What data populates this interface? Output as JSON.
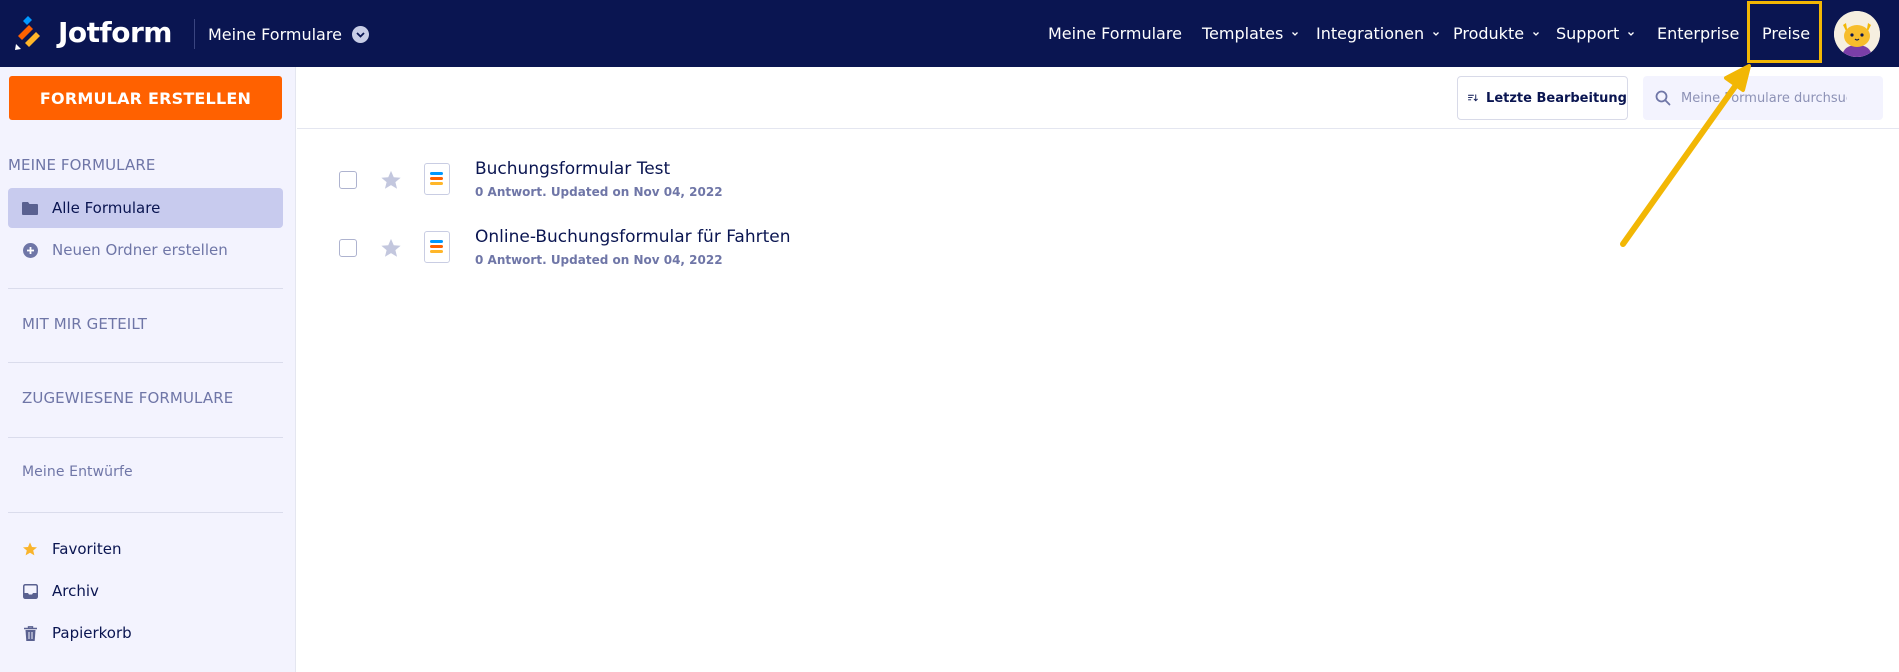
{
  "brand": {
    "name": "Jotform",
    "colors": {
      "navy": "#0a1551",
      "orange": "#ff6100",
      "highlight": "#f2b705",
      "active": "#c8cbee"
    }
  },
  "topbar": {
    "forms_switch": "Meine Formulare",
    "nav": [
      {
        "label": "Meine Formulare",
        "dropdown": false
      },
      {
        "label": "Templates",
        "dropdown": true
      },
      {
        "label": "Integrationen",
        "dropdown": true
      },
      {
        "label": "Produkte",
        "dropdown": true
      },
      {
        "label": "Support",
        "dropdown": true
      },
      {
        "label": "Enterprise",
        "dropdown": false
      },
      {
        "label": "Preise",
        "dropdown": false,
        "highlighted": true
      }
    ],
    "avatar_icon": "cat-avatar"
  },
  "sidebar": {
    "create_button": "FORMULAR ERSTELLEN",
    "section_my_forms": "MEINE FORMULARE",
    "all_forms": "Alle Formulare",
    "new_folder": "Neuen Ordner erstellen",
    "shared_with_me": "MIT MIR GETEILT",
    "assigned_forms": "ZUGEWIESENE FORMULARE",
    "drafts": "Meine Entwürfe",
    "favorites": "Favoriten",
    "archive": "Archiv",
    "trash": "Papierkorb"
  },
  "toolbar": {
    "sort_label": "Letzte Bearbeitung",
    "search_placeholder": "Meine Formulare durchsuchen"
  },
  "forms": [
    {
      "title": "Buchungsformular Test",
      "meta": "0 Antwort. Updated on Nov 04, 2022"
    },
    {
      "title": "Online-Buchungsformular für Fahrten",
      "meta": "0 Antwort. Updated on Nov 04, 2022"
    }
  ]
}
